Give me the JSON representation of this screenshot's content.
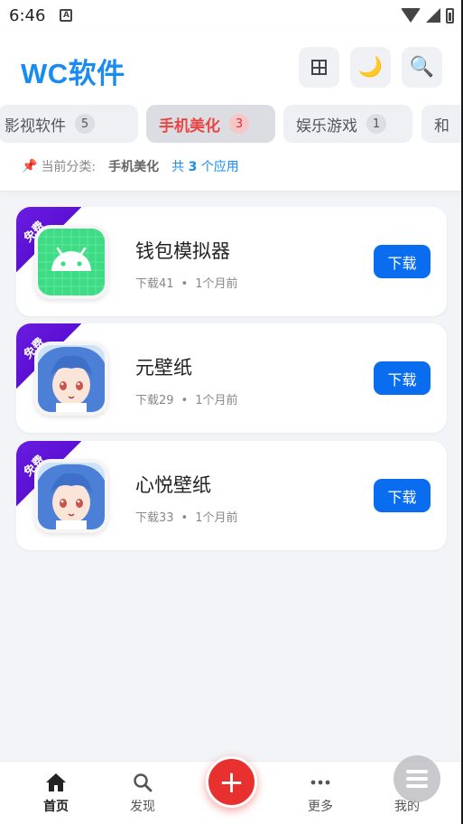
{
  "status_bar": {
    "time": "6:46",
    "notification_glyph": "A"
  },
  "header": {
    "title": "WC软件"
  },
  "icons": {
    "grid": "grid-icon",
    "moon": "🌙",
    "search": "🔍"
  },
  "tabs": [
    {
      "label": "影视软件",
      "count": "5"
    },
    {
      "label": "手机美化",
      "count": "3"
    },
    {
      "label": "娱乐游戏",
      "count": "1"
    },
    {
      "label": "和"
    }
  ],
  "current_category": {
    "pin": "📌",
    "label": "当前分类:",
    "name": "手机美化",
    "total_prefix": "共",
    "total_count": "3",
    "total_suffix": "个应用"
  },
  "apps": [
    {
      "badge": "免费",
      "name": "钱包模拟器",
      "downloads": "下载41",
      "time": "1个月前",
      "action": "下载"
    },
    {
      "badge": "免费",
      "name": "元壁纸",
      "downloads": "下载29",
      "time": "1个月前",
      "action": "下载"
    },
    {
      "badge": "免费",
      "name": "心悦壁纸",
      "downloads": "下载33",
      "time": "1个月前",
      "action": "下载"
    }
  ],
  "meta_dot": "•",
  "bottom_nav": {
    "home": "首页",
    "discover": "发现",
    "add": "+",
    "more": "更多",
    "mine": "我的"
  },
  "colors": {
    "accent": "#1a8cf0",
    "active_tab": "#e84545",
    "download": "#0a6df0",
    "badge": "#6a1de0",
    "fab": "#e8302f"
  }
}
